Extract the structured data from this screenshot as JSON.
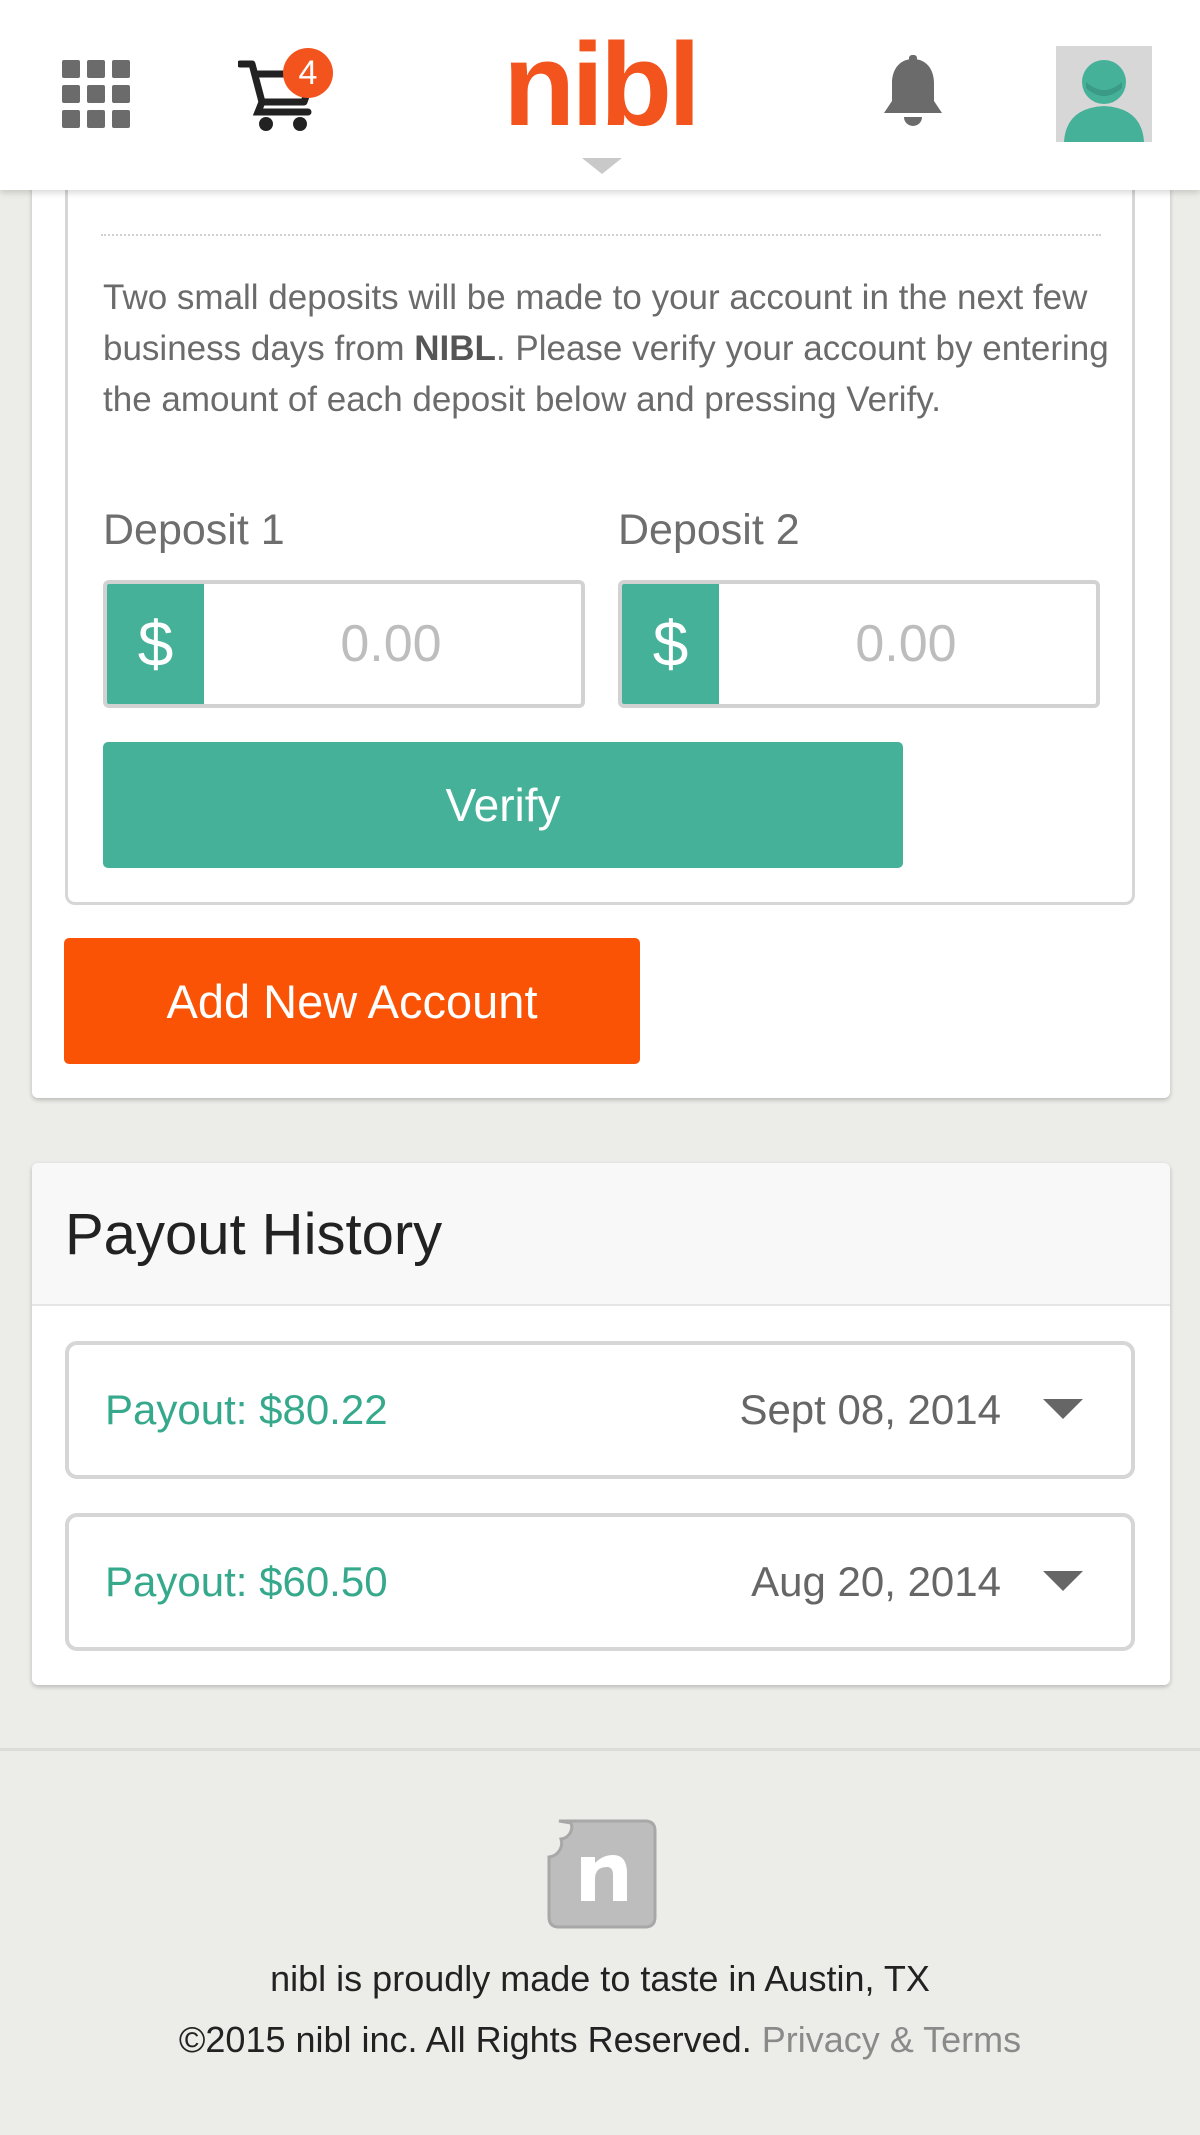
{
  "header": {
    "logo": "nibl",
    "cart_count": "4",
    "icons": [
      "apps-grid-icon",
      "cart-icon",
      "bell-icon",
      "user-avatar-icon"
    ],
    "accent_color": "#f3541d"
  },
  "verification": {
    "instructions_before": "Two small deposits will be made to your account in the next few business days from ",
    "instructions_brand": "NIBL",
    "instructions_after": ". Please verify your account by entering the amount of each deposit below and pressing Verify.",
    "deposit1": {
      "label": "Deposit 1",
      "currency": "$",
      "placeholder": "0.00"
    },
    "deposit2": {
      "label": "Deposit 2",
      "currency": "$",
      "placeholder": "0.00"
    },
    "verify_label": "Verify",
    "button_color": "#46b199"
  },
  "add_account_label": "Add New Account",
  "add_account_color": "#fb5305",
  "payout_history": {
    "title": "Payout History",
    "items": [
      {
        "amount": "Payout: $80.22",
        "date": "Sept 08, 2014"
      },
      {
        "amount": "Payout: $60.50",
        "date": "Aug 20, 2014"
      }
    ]
  },
  "footer": {
    "tagline": "nibl is proudly made to taste in Austin, TX",
    "copyright": "©2015 nibl inc. All Rights Reserved.",
    "link": "Privacy & Terms"
  }
}
